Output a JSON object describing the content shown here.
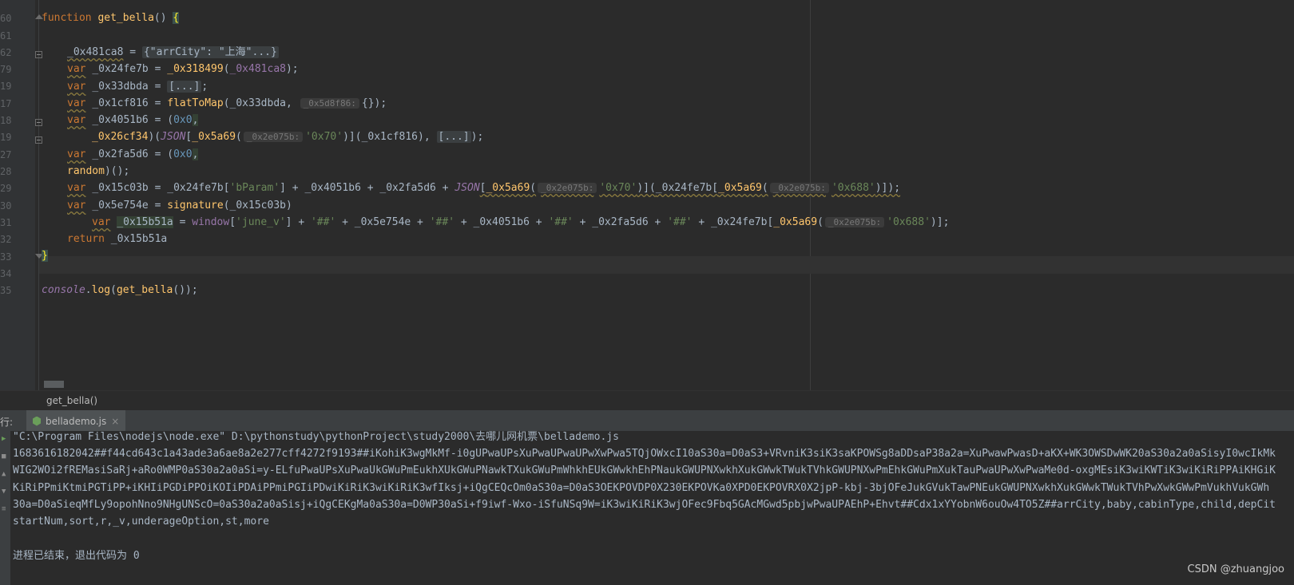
{
  "editor": {
    "line_numbers": [
      "60",
      "61",
      "62",
      "79",
      "19",
      "17",
      "18",
      "19",
      "27",
      "28",
      "29",
      "30",
      "31",
      "32",
      "33",
      "34",
      "35"
    ],
    "fold_box_object": "{\"arrCity\": \"上海\"...}",
    "fold_box_array": "[...]",
    "hints": {
      "h_5d8f86": "_0x5d8f86:",
      "h_2e075b": "_0x2e075b:"
    },
    "tokens": {
      "function": "function",
      "get_bella": "get_bella",
      "var": "var",
      "return": "return",
      "v481ca8": "_0x481ca8",
      "v24fe7b": "_0x24fe7b",
      "v318499": "_0x318499",
      "v33dbda": "_0x33dbda",
      "v1cf816": "_0x1cf816",
      "flatToMap": "flatToMap",
      "v4051b6": "_0x4051b6",
      "hex0": "0x0",
      "v26cf34": "_0x26cf34",
      "JSON": "JSON",
      "v5a69": "_0x5a69",
      "s0x70": "'0x70'",
      "v2fa5d6": "_0x2fa5d6",
      "random": "random",
      "v15c03b": "_0x15c03b",
      "bParam": "'bParam'",
      "s0x688": "'0x688'",
      "v5e754e": "_0x5e754e",
      "signature": "signature",
      "v15b51a": "_0x15b51a",
      "window": "window",
      "june_v": "'june_v'",
      "hashes": "'##'",
      "console": "console",
      "log": "log"
    }
  },
  "breadcrumb": "get_bella()",
  "run_panel": {
    "label": "行:",
    "tab_label": "bellademo.js",
    "tab_close": "×"
  },
  "console_output": [
    "\"C:\\Program Files\\nodejs\\node.exe\" D:\\pythonstudy\\pythonProject\\study2000\\去哪儿网机票\\bellademo.js",
    "1683616182042##f44cd643c1a43ade3a6ae8a2e277cff4272f9193##iKohiK3wgMkMf-i0gUPwaUPsXuPwaUPwaUPwXwPwa5TQjOWxcI10aS30a=D0aS3+VRvniK3siK3saKPOWSg8aDDsaP38a2a=XuPwawPwasD+aKX+WK3OWSDwWK20aS30a2a0aSisyI0wcIkMk",
    "WIG2WOi2fREMasiSaRj+aRo0WMP0aS30a2a0aSi=y-ELfuPwaUPsXuPwaUkGWuPmEukhXUkGWuPNawkTXukGWuPmWhkhEUkGWwkhEhPNaukGWUPNXwkhXukGWwkTWukTVhkGWUPNXwPmEhkGWuPmXukTauPwaUPwXwPwaMe0d-oxgMEsiK3wiKWTiK3wiKiRiPPAiKHGiK",
    "KiRiPPmiKtmiPGTiPP+iKHIiPGDiPPOiKOIiPDAiPPmiPGIiPDwiKiRiK3wiKiRiK3wfIksj+iQgCEQcOm0aS30a=D0aS3OEKPOVDP0X230EKPOVKa0XPD0EKPOVRX0X2jpP-kbj-3bjOFeJukGVukTawPNEukGWUPNXwkhXukGWwkTWukTVhPwXwkGWwPmVukhVukGWh",
    "30a=D0aSieqMfLy9opohNno9NHgUNScO=0aS30a2a0aSisj+iQgCEKgMa0aS30a=D0WP30aSi+f9iwf-Wxo-iSfuNSq9W=iK3wiKiRiK3wjOFec9Fbq5GAcMGwd5pbjwPwaUPAEhP+Ehvt##Cdx1xYYobnW6ouOw4TO5Z##arrCity,baby,cabinType,child,depCit",
    "startNum,sort,r,_v,underageOption,st,more",
    "",
    "进程已结束，退出代码为 0"
  ],
  "watermark": "CSDN @zhuangjoo",
  "colors": {
    "background": "#2b2b2b",
    "keyword": "#cc7832",
    "function": "#ffc66d",
    "string": "#6a8759",
    "number": "#6897bb",
    "global": "#9876aa"
  }
}
